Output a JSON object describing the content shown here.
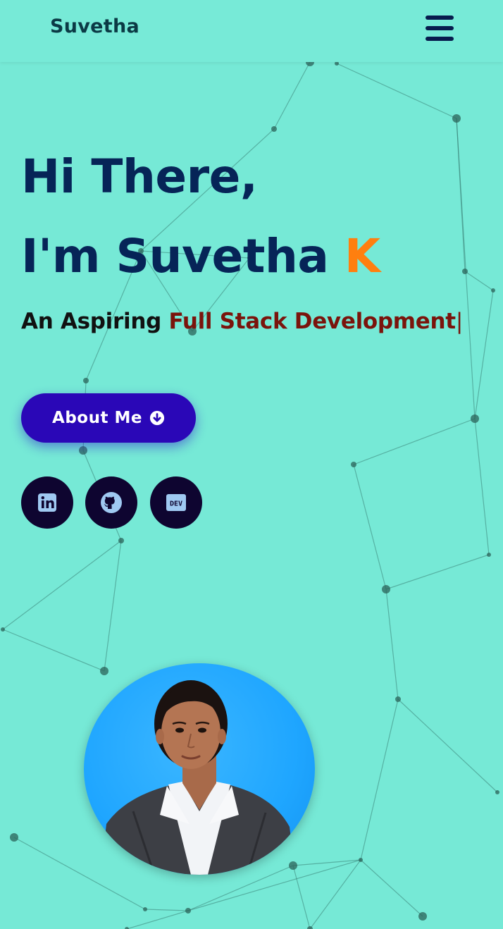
{
  "header": {
    "brand": "Suvetha",
    "menu_icon": "hamburger-menu-icon"
  },
  "hero": {
    "line1": "Hi There,",
    "line2_prefix": "I'm Suvetha ",
    "line2_accent": "K",
    "subtitle_prefix": "An Aspiring ",
    "subtitle_typed": "Full Stack Development",
    "cursor": "|",
    "about_button": "About Me",
    "about_icon": "arrow-down-circle-icon"
  },
  "social": [
    {
      "name": "linkedin",
      "icon": "linkedin-icon"
    },
    {
      "name": "github",
      "icon": "github-icon"
    },
    {
      "name": "dev",
      "icon": "dev-icon",
      "label": "DEV"
    }
  ],
  "profile": {
    "photo": "profile-photo"
  },
  "colors": {
    "background": "#76e9d6",
    "heading": "#062457",
    "accent": "#ff7f0f",
    "typed_text": "#7a140c",
    "button": "#2a07b7",
    "social_bg": "#0e0530"
  }
}
